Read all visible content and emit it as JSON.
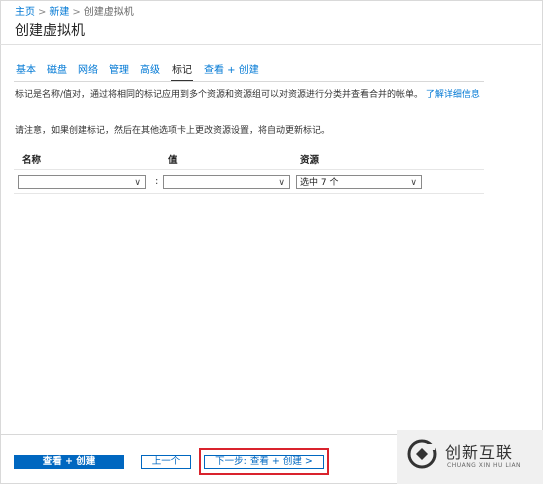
{
  "breadcrumb": {
    "home": "主页",
    "new": "新建",
    "current": "创建虚拟机"
  },
  "page_title": "创建虚拟机",
  "tabs": [
    {
      "label": "基本",
      "active": false
    },
    {
      "label": "磁盘",
      "active": false
    },
    {
      "label": "网络",
      "active": false
    },
    {
      "label": "管理",
      "active": false
    },
    {
      "label": "高级",
      "active": false
    },
    {
      "label": "标记",
      "active": true
    },
    {
      "label": "查看 + 创建",
      "active": false
    }
  ],
  "description": "标记是名称/值对，通过将相同的标记应用到多个资源和资源组可以对资源进行分类并查看合并的帐单。",
  "learn_more": "了解详细信息",
  "note": "请注意，如果创建标记，然后在其他选项卡上更改资源设置，将自动更新标记。",
  "table": {
    "headers": {
      "name": "名称",
      "value": "值",
      "resource": "资源"
    },
    "row": {
      "name": "",
      "value": "",
      "resource": "选中 7 个"
    },
    "separator": ":"
  },
  "footer": {
    "review_create": "查看 + 创建",
    "previous": "上一个",
    "next": "下一步: 查看 + 创建 >"
  },
  "watermark": {
    "brand": "创新互联",
    "sub": "CHUANG XIN HU LIAN"
  },
  "colors": {
    "accent": "#0078d4",
    "primary_button": "#0067c0",
    "highlight": "#d9232d"
  }
}
